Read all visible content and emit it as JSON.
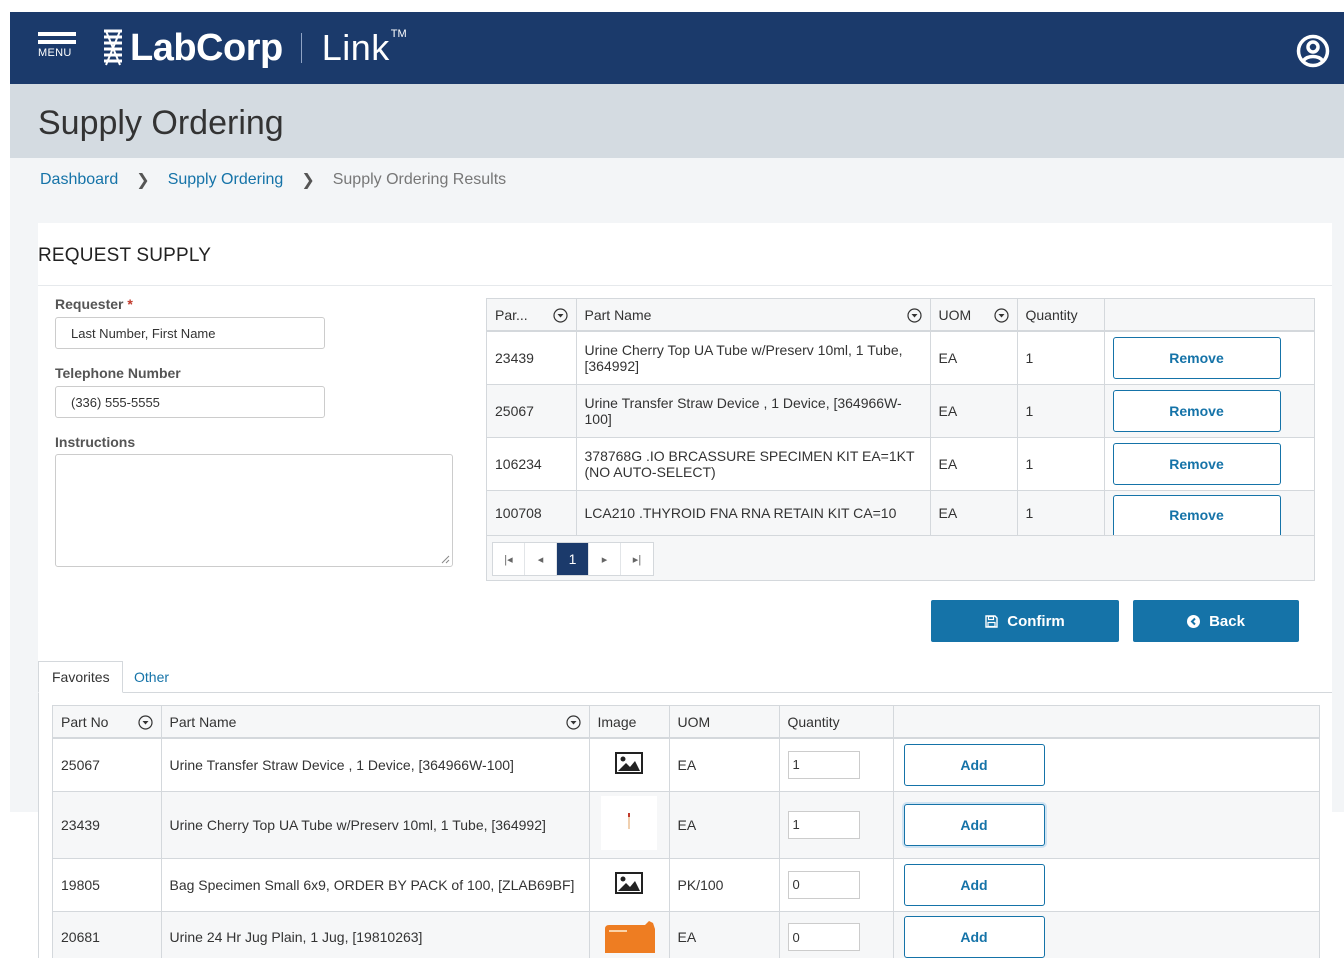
{
  "header": {
    "menu_label": "MENU",
    "brand": "LabCorp",
    "product": "Link",
    "trademark": "TM",
    "menu_icon": "hamburger-icon",
    "user_icon": "user-account-icon"
  },
  "page": {
    "title": "Supply Ordering",
    "breadcrumb": [
      {
        "label": "Dashboard"
      },
      {
        "label": "Supply Ordering"
      },
      {
        "label": "Supply Ordering Results"
      }
    ]
  },
  "request": {
    "section_title": "REQUEST SUPPLY",
    "requester_label": "Requester",
    "required_mark": "*",
    "requester_value": "Last Number, First Name",
    "telephone_label": "Telephone Number",
    "telephone_value": "(336) 555-5555",
    "instructions_label": "Instructions",
    "instructions_value": ""
  },
  "selected": {
    "columns": [
      "Par...",
      "Part Name",
      "UOM",
      "Quantity",
      ""
    ],
    "rows": [
      {
        "part_no": "23439",
        "part_name": "Urine Cherry Top UA Tube w/Preserv 10ml, 1 Tube, [364992]",
        "uom": "EA",
        "quantity": "1",
        "action": "Remove"
      },
      {
        "part_no": "25067",
        "part_name": "Urine Transfer Straw Device , 1 Device, [364966W-100]",
        "uom": "EA",
        "quantity": "1",
        "action": "Remove"
      },
      {
        "part_no": "106234",
        "part_name": "378768G .IO BRCASSURE SPECIMEN KIT EA=1KT (NO AUTO-SELECT)",
        "uom": "EA",
        "quantity": "1",
        "action": "Remove"
      },
      {
        "part_no": "100708",
        "part_name": "LCA210 .THYROID FNA RNA RETAIN KIT CA=10",
        "uom": "EA",
        "quantity": "1",
        "action": "Remove"
      }
    ],
    "pager": {
      "first": "|◂",
      "prev": "◂",
      "current_page": "1",
      "next": "▸",
      "last": "▸|"
    }
  },
  "actions": {
    "confirm_label": "Confirm",
    "back_label": "Back",
    "confirm_icon": "save-icon",
    "back_icon": "back-arrow-circle-icon"
  },
  "tabs": [
    {
      "label": "Favorites",
      "active": true
    },
    {
      "label": "Other",
      "active": false
    }
  ],
  "favorites": {
    "columns": [
      "Part No",
      "Part Name",
      "Image",
      "UOM",
      "Quantity",
      ""
    ],
    "rows": [
      {
        "part_no": "25067",
        "part_name": "Urine Transfer Straw Device , 1 Device, [364966W-100]",
        "image": "image-placeholder-icon",
        "uom": "EA",
        "quantity": "1",
        "action": "Add"
      },
      {
        "part_no": "23439",
        "part_name": "Urine Cherry Top UA Tube w/Preserv 10ml, 1 Tube, [364992]",
        "image": "cherry-top-tube-thumbnail",
        "uom": "EA",
        "quantity": "1",
        "action": "Add"
      },
      {
        "part_no": "19805",
        "part_name": "Bag Specimen Small 6x9, ORDER BY PACK of 100, [ZLAB69BF]",
        "image": "image-placeholder-icon",
        "uom": "PK/100",
        "quantity": "0",
        "action": "Add"
      },
      {
        "part_no": "20681",
        "part_name": "Urine 24 Hr Jug Plain, 1 Jug, [19810263]",
        "image": "orange-jug-thumbnail",
        "uom": "EA",
        "quantity": "0",
        "action": "Add"
      }
    ]
  },
  "colors": {
    "header_bg": "#1b3a6b",
    "page_header_bg": "#d4dbe1",
    "accent": "#1573a8",
    "required": "#c0392b"
  }
}
